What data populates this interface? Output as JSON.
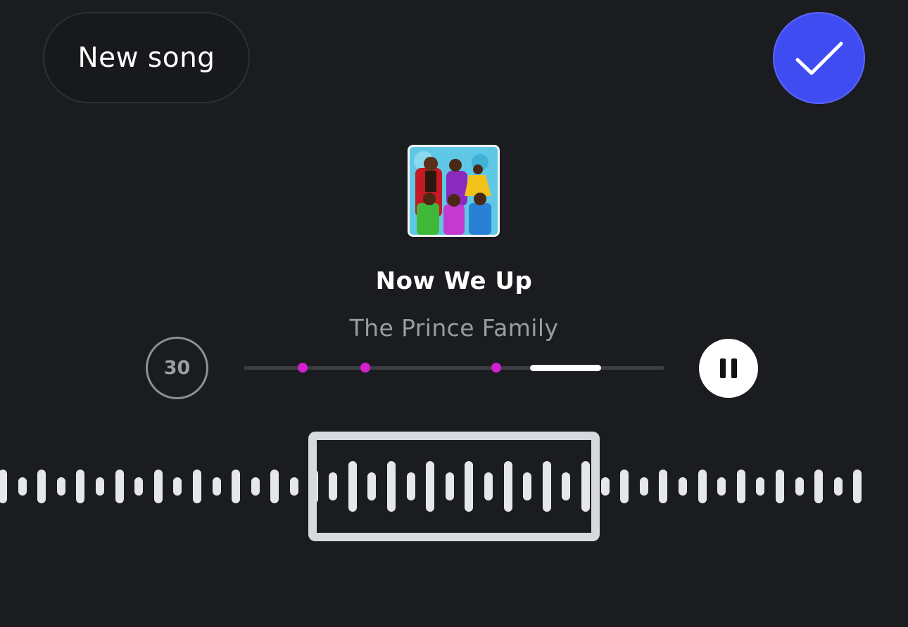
{
  "header": {
    "new_song_label": "New song",
    "confirm_icon": "checkmark-icon"
  },
  "song": {
    "title": "Now We Up",
    "artist": "The Prince Family",
    "cover_icon": "album-cover"
  },
  "player": {
    "duration_label": "30",
    "playback_progress_start": 0.68,
    "playback_progress_end": 0.85,
    "marker_positions": [
      0.14,
      0.29,
      0.6
    ],
    "pause_icon": "pause-icon"
  },
  "colors": {
    "background": "#1a1c20",
    "accent": "#3f4cf2",
    "marker": "#d21fd0"
  }
}
